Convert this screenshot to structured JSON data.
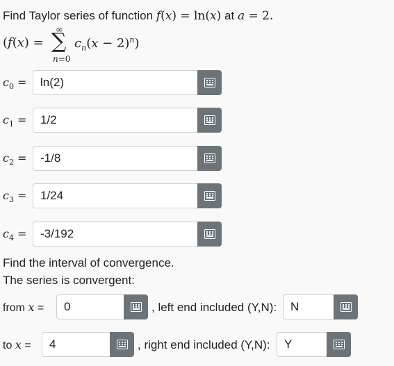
{
  "question": {
    "prefix": "Find Taylor series of function",
    "function_expr": "f(x) = ln(x)",
    "at_word": "at",
    "point_expr": "a = 2.",
    "series_formula": {
      "lhs": "(f(x) =",
      "sum_top": "∞",
      "sum_symbol": "∑",
      "sum_bottom": "n=0",
      "term": "cn(x − 2)n)"
    }
  },
  "coefficients": [
    {
      "label": "c0 =",
      "value": "ln(2)"
    },
    {
      "label": "c1 =",
      "value": "1/2"
    },
    {
      "label": "c2 =",
      "value": "-1/8"
    },
    {
      "label": "c3 =",
      "value": "1/24"
    },
    {
      "label": "c4 =",
      "value": "-3/192"
    }
  ],
  "interval": {
    "prompt": "Find the interval of convergence.",
    "statement": "The series is convergent:",
    "from_label": "from x =",
    "from_value": "0",
    "left_included_label": ", left end included (Y,N):",
    "left_included_value": "N",
    "to_label": "to x =",
    "to_value": "4",
    "right_included_label": ", right end included (Y,N):",
    "right_included_value": "Y"
  },
  "icons": {
    "keyboard_button_icon": "keyboard-icon",
    "button_color": "#6d7479"
  }
}
